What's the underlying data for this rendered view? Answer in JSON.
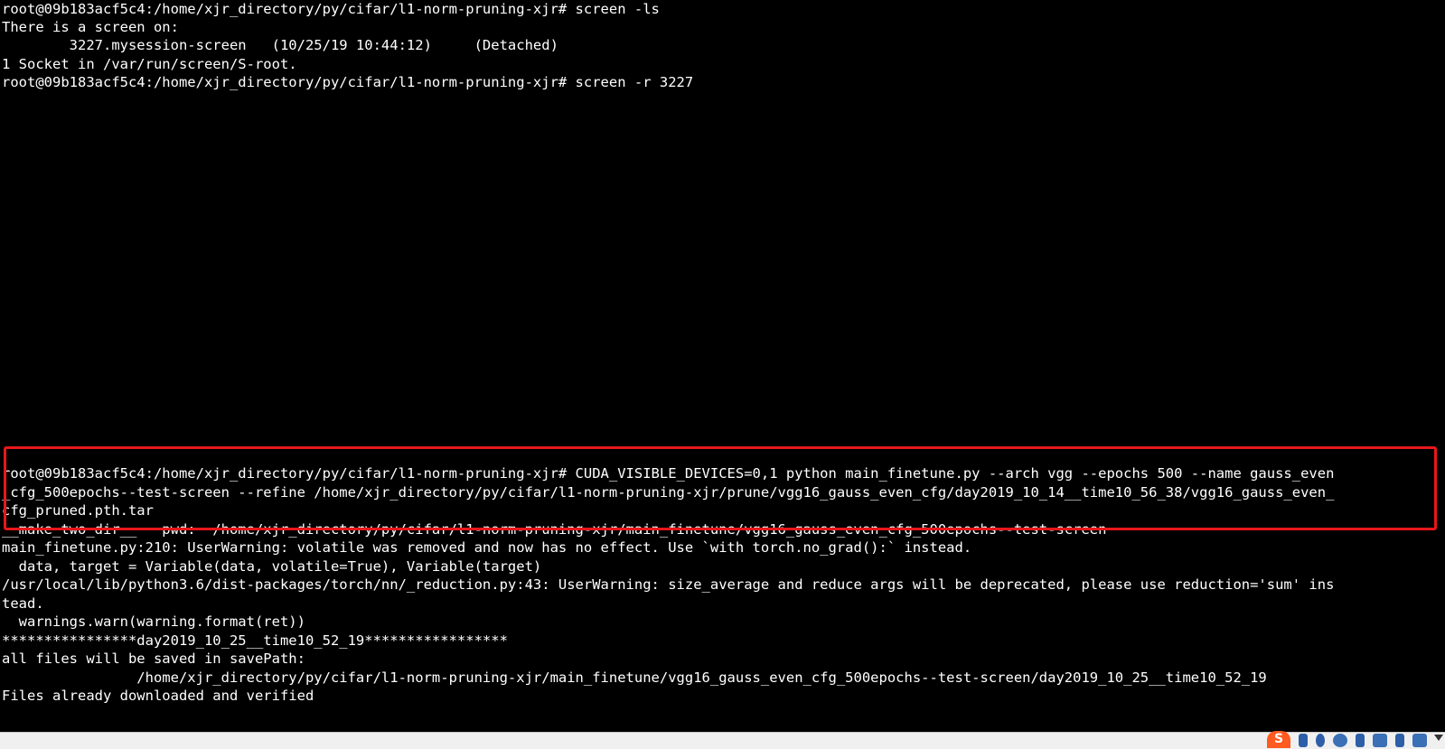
{
  "terminal": {
    "lines": [
      "root@09b183acf5c4:/home/xjr_directory/py/cifar/l1-norm-pruning-xjr# screen -ls",
      "There is a screen on:",
      "        3227.mysession-screen   (10/25/19 10:44:12)     (Detached)",
      "1 Socket in /var/run/screen/S-root.",
      "root@09b183acf5c4:/home/xjr_directory/py/cifar/l1-norm-pruning-xjr# screen -r 3227",
      "root@09b183acf5c4:/home/xjr_directory/py/cifar/l1-norm-pruning-xjr# CUDA_VISIBLE_DEVICES=0,1 python main_finetune.py --arch vgg --epochs 500 --name gauss_even",
      "_cfg_500epochs--test-screen --refine /home/xjr_directory/py/cifar/l1-norm-pruning-xjr/prune/vgg16_gauss_even_cfg/day2019_10_14__time10_56_38/vgg16_gauss_even_",
      "cfg_pruned.pth.tar",
      "__make_two_dir__   pwd:  /home/xjr_directory/py/cifar/l1-norm-pruning-xjr/main_finetune/vgg16_gauss_even_cfg_500epochs--test-screen",
      "main_finetune.py:210: UserWarning: volatile was removed and now has no effect. Use `with torch.no_grad():` instead.",
      "  data, target = Variable(data, volatile=True), Variable(target)",
      "/usr/local/lib/python3.6/dist-packages/torch/nn/_reduction.py:43: UserWarning: size_average and reduce args will be deprecated, please use reduction='sum' ins",
      "tead.",
      "  warnings.warn(warning.format(ret))",
      "****************day2019_10_25__time10_52_19*****************",
      "all files will be saved in savePath:",
      "                /home/xjr_directory/py/cifar/l1-norm-pruning-xjr/main_finetune/vgg16_gauss_even_cfg_500epochs--test-screen/day2019_10_25__time10_52_19",
      "Files already downloaded and verified"
    ]
  },
  "taskbar": {
    "ime_glyph": "S"
  },
  "colors": {
    "background": "#000000",
    "text": "#ffffff",
    "highlight_border": "#e8171b"
  }
}
